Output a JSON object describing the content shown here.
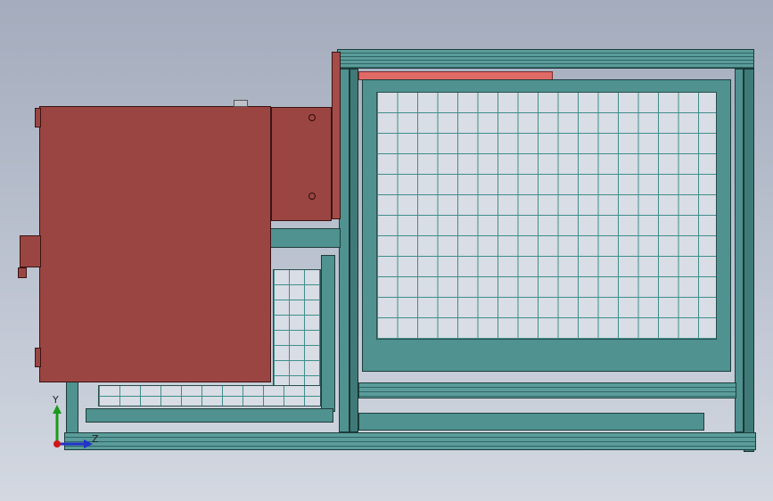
{
  "viewport": {
    "title": "",
    "background_top": "#a4acbd",
    "background_bottom": "#d3d8e1"
  },
  "colors": {
    "frame_teal": "#4f9290",
    "mesh_teal": "#3f8e8c",
    "cabinet_red": "#9b4542",
    "highlight_red": "#e06a66"
  },
  "axis_triad": {
    "y_label": "Y",
    "z_label": "Z",
    "x_color": "#d01818",
    "y_color": "#1a9a1a",
    "z_color": "#2233cc"
  },
  "model": {
    "parts": [
      "main-frame",
      "mesh-panel",
      "cabinet",
      "motor",
      "side-frame"
    ]
  }
}
